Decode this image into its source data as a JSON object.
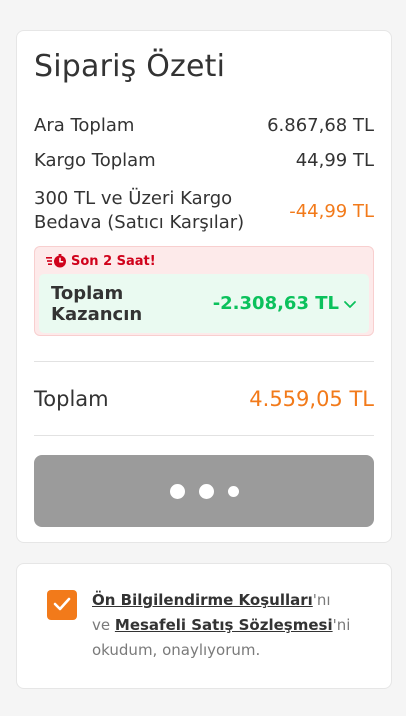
{
  "summary": {
    "title": "Sipariş Özeti",
    "subtotal": {
      "label": "Ara Toplam",
      "value": "6.867,68 TL"
    },
    "cargo": {
      "label": "Kargo Toplam",
      "value": "44,99 TL"
    },
    "free_cargo": {
      "label": "300 TL ve Üzeri Kargo Bedava (Satıcı Karşılar)",
      "value": "-44,99 TL"
    },
    "promo": {
      "badge_text": "Son 2 Saat!",
      "gain_label": "Toplam Kazancın",
      "gain_value": "-2.308,63 TL"
    },
    "total": {
      "label": "Toplam",
      "value": "4.559,05 TL"
    },
    "confirm_button": {
      "state": "loading"
    }
  },
  "consent": {
    "checked": true,
    "link1": "Ön Bilgilendirme Koşulları",
    "text1": "'nı ve",
    "link2": "Mesafeli Satış Sözleşmesi",
    "text2": "'ni okudum, onaylıyorum."
  },
  "colors": {
    "accent": "#f27a1a",
    "success": "#0bc15c",
    "alert": "#d0021b",
    "button_disabled": "#9b9b9b"
  },
  "icons": {
    "promo": "stopwatch-icon",
    "gain_expand": "chevron-down-icon",
    "checkbox": "checkmark-icon"
  }
}
